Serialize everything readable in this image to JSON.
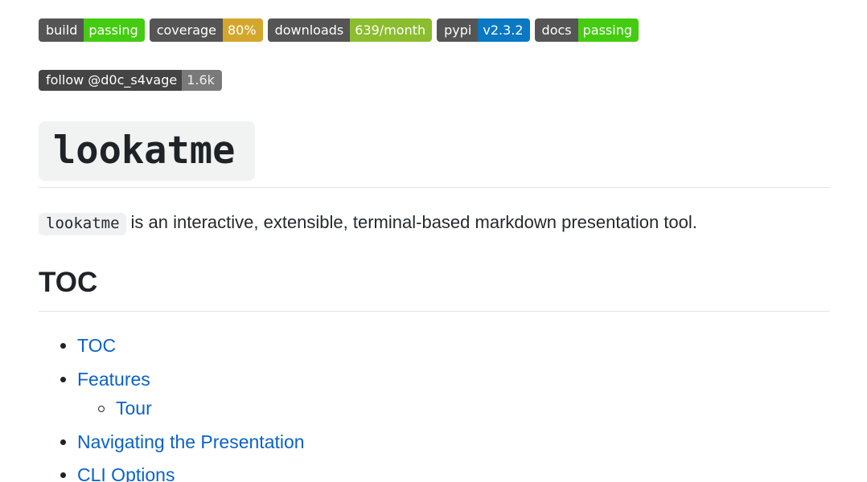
{
  "badges": [
    {
      "label": "build",
      "value": "passing",
      "color": "#44cc11"
    },
    {
      "label": "coverage",
      "value": "80%",
      "color": "#dfb317"
    },
    {
      "label": "downloads",
      "value": "639/month",
      "color": "#97ca00"
    },
    {
      "label": "pypi",
      "value": "v2.3.2",
      "color": "#007ec6"
    },
    {
      "label": "docs",
      "value": "passing",
      "color": "#4c1"
    }
  ],
  "social_badge": {
    "label": "follow @d0c_s4vage",
    "value": "1.6k"
  },
  "title": "lookatme",
  "intro": {
    "code": "lookatme",
    "text": "is an interactive, extensible, terminal-based markdown presentation tool."
  },
  "toc": {
    "heading": "TOC",
    "items": [
      {
        "label": "TOC"
      },
      {
        "label": "Features"
      },
      {
        "label": "Tour"
      },
      {
        "label": "Navigating the Presentation"
      },
      {
        "label": "CLI Options"
      }
    ]
  },
  "colors": {
    "link": "#0a62c9",
    "badge_left": "#555555"
  }
}
